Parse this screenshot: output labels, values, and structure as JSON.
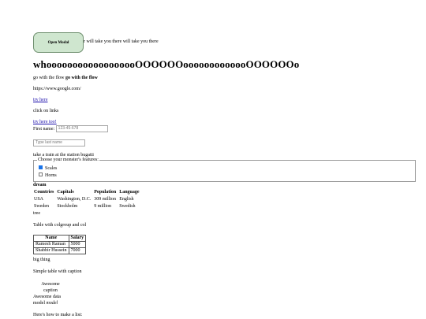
{
  "modal_button_label": "Open Modal",
  "marquee_text": "r will take you there will take you there",
  "big_heading": "whoooooooooooooooooOOOOOOooooooooooooOOOOOOo",
  "flow": {
    "normal": "go with the flow",
    "bold": "go with the flow"
  },
  "url_text": "https://www.google.com/",
  "link1": "try here",
  "click_text": "click on links",
  "link2": "try here too!",
  "first_name": {
    "label": "First name:",
    "placeholder": "123-45-678"
  },
  "last_name": {
    "placeholder": "Type last name"
  },
  "train_text": "take a train at the station bugatti",
  "features": {
    "legend": "Choose your monster's features:",
    "options": [
      {
        "label": "Scales",
        "checked": true
      },
      {
        "label": "Horns",
        "checked": false
      }
    ]
  },
  "dream_text": "dream",
  "countries_table": {
    "headers": [
      "Countries",
      "Capitals",
      "Population",
      "Language"
    ],
    "rows": [
      [
        "USA",
        "Washington, D.C.",
        "309 million",
        "English"
      ],
      [
        "Sweden",
        "Stockholm",
        "9 million",
        "Swedish"
      ]
    ]
  },
  "tree_text": "tree",
  "colgroup_caption": "Table with colgroup and col",
  "salary_table": {
    "headers": [
      "Name",
      "Salary"
    ],
    "rows": [
      [
        "Ramesh Raman",
        "5000"
      ],
      [
        "Shabbir Hussein",
        "7000"
      ]
    ]
  },
  "big_thing": "big thing",
  "simple_caption": "Simple table with caption",
  "awesome_caption": [
    "Awesome",
    "caption"
  ],
  "awesome_data": "Awesome data",
  "model_text": {
    "normal": "model",
    "italic": "model"
  },
  "list_text": "Here's how to make a list:"
}
